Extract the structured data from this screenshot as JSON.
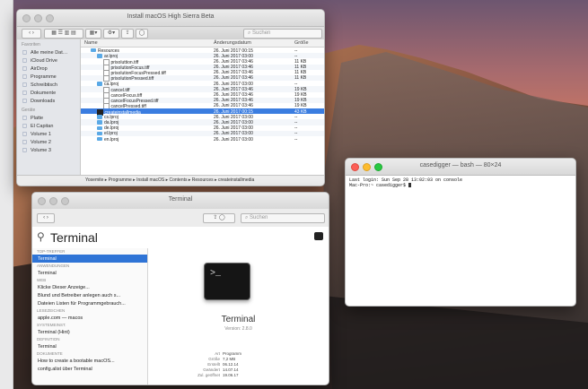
{
  "finder": {
    "title": "Install macOS High Sierra Beta",
    "search_placeholder": "Suchen",
    "columns": {
      "name": "Name",
      "date": "Änderungsdatum",
      "size": "Größe"
    },
    "sidebar": [
      {
        "type": "section",
        "label": "Favoriten"
      },
      {
        "type": "item",
        "label": "Alle meine Dat…",
        "icon": "all-files-icon"
      },
      {
        "type": "item",
        "label": "iCloud Drive",
        "icon": "cloud-icon"
      },
      {
        "type": "item",
        "label": "AirDrop",
        "icon": "airdrop-icon"
      },
      {
        "type": "item",
        "label": "Programme",
        "icon": "apps-icon"
      },
      {
        "type": "item",
        "label": "Schreibtisch",
        "icon": "desktop-icon"
      },
      {
        "type": "item",
        "label": "Dokumente",
        "icon": "documents-icon"
      },
      {
        "type": "item",
        "label": "Downloads",
        "icon": "downloads-icon"
      },
      {
        "type": "section",
        "label": "Geräte"
      },
      {
        "type": "item",
        "label": "Platte",
        "icon": "disk-icon"
      },
      {
        "type": "item",
        "label": "El Capitan",
        "icon": "disk-icon"
      },
      {
        "type": "item",
        "label": "Volume 1",
        "icon": "disk-icon"
      },
      {
        "type": "item",
        "label": "Volume 2",
        "icon": "disk-icon"
      },
      {
        "type": "item",
        "label": "Volume 3",
        "icon": "disk-icon"
      }
    ],
    "rows": [
      {
        "indent": 1,
        "kind": "folder",
        "name": "Resources",
        "date": "26. Juni 2017 00:15",
        "size": "--"
      },
      {
        "indent": 2,
        "kind": "folder",
        "name": "ar.lproj",
        "date": "26. Juni 2017 03:00",
        "size": "--"
      },
      {
        "indent": 3,
        "kind": "doc",
        "name": "prisoluttion.tiff",
        "date": "26. Juni 2017 03:46",
        "size": "11 KB"
      },
      {
        "indent": 3,
        "kind": "doc",
        "name": "prisolutionFocus.tiff",
        "date": "26. Juni 2017 03:46",
        "size": "11 KB"
      },
      {
        "indent": 3,
        "kind": "doc",
        "name": "prisolutionFocusPressed.tiff",
        "date": "26. Juni 2017 03:46",
        "size": "11 KB"
      },
      {
        "indent": 3,
        "kind": "doc",
        "name": "prisolutionPressed.tiff",
        "date": "26. Juni 2017 03:46",
        "size": "11 KB"
      },
      {
        "indent": 2,
        "kind": "folder",
        "name": "ca.lproj",
        "date": "26. Juni 2017 03:00",
        "size": "--"
      },
      {
        "indent": 3,
        "kind": "doc",
        "name": "cancel.tiff",
        "date": "26. Juni 2017 03:46",
        "size": "19 KB"
      },
      {
        "indent": 3,
        "kind": "doc",
        "name": "cancelFocus.tiff",
        "date": "26. Juni 2017 03:46",
        "size": "19 KB"
      },
      {
        "indent": 3,
        "kind": "doc",
        "name": "cancelFocusPressed.tiff",
        "date": "26. Juni 2017 03:46",
        "size": "19 KB"
      },
      {
        "indent": 3,
        "kind": "doc",
        "name": "cancelPressed.tiff",
        "date": "26. Juni 2017 03:46",
        "size": "19 KB"
      },
      {
        "indent": 2,
        "kind": "exec",
        "name": "createinstallmedia",
        "date": "26. Juni 2017 00:15",
        "size": "43 KB",
        "selected": true
      },
      {
        "indent": 2,
        "kind": "folder",
        "name": "cs.lproj",
        "date": "26. Juni 2017 03:00",
        "size": "--"
      },
      {
        "indent": 2,
        "kind": "folder",
        "name": "da.lproj",
        "date": "26. Juni 2017 03:00",
        "size": "--"
      },
      {
        "indent": 2,
        "kind": "folder",
        "name": "de.lproj",
        "date": "26. Juni 2017 03:00",
        "size": "--"
      },
      {
        "indent": 2,
        "kind": "folder",
        "name": "el.lproj",
        "date": "26. Juni 2017 03:00",
        "size": "--"
      },
      {
        "indent": 2,
        "kind": "folder",
        "name": "en.lproj",
        "date": "26. Juni 2017 03:00",
        "size": "--"
      }
    ],
    "pathbar": "Yosemite ▸ Programme ▸ Install macOS ▸ Contents ▸ Resources ▸ createinstallmedia"
  },
  "spotlight": {
    "title": "Terminal",
    "query": "Terminal",
    "search_placeholder": "Suchen",
    "results": [
      {
        "type": "section",
        "label": "Top-Treffer"
      },
      {
        "type": "item",
        "label": "Terminal",
        "selected": true
      },
      {
        "type": "section",
        "label": "Anwendungen"
      },
      {
        "type": "item",
        "label": "Terminal"
      },
      {
        "type": "section",
        "label": "Web"
      },
      {
        "type": "item",
        "label": "Klicke Dieser Anzeige..."
      },
      {
        "type": "item",
        "label": "Blund und Betreiber anlegen auch s..."
      },
      {
        "type": "item",
        "label": "Dateien Listen für Programmgebrauch..."
      },
      {
        "type": "section",
        "label": "Lesezeichen"
      },
      {
        "type": "item",
        "label": "apple.com — macos"
      },
      {
        "type": "section",
        "label": "Systemeinst."
      },
      {
        "type": "item",
        "label": "Terminal (Hint)"
      },
      {
        "type": "section",
        "label": "Definition"
      },
      {
        "type": "item",
        "label": "Terminal"
      },
      {
        "type": "section",
        "label": "Dokumente"
      },
      {
        "type": "item",
        "label": "How to create a bootable macOS..."
      },
      {
        "type": "item",
        "label": "config.alist über Terminal"
      }
    ],
    "preview": {
      "app_name": "Terminal",
      "version": "Version: 2.8.0",
      "meta": [
        {
          "k": "Art",
          "v": "Programm"
        },
        {
          "k": "Größe",
          "v": "7,2 MB"
        },
        {
          "k": "Erstellt",
          "v": "06.12.14"
        },
        {
          "k": "Geändert",
          "v": "14.07.14"
        },
        {
          "k": "Zul. geöffnet",
          "v": "19.06.17"
        }
      ]
    }
  },
  "terminal": {
    "title": "casedigger — bash — 80×24",
    "lines": [
      "Last login: Sun Sep 28 13:02:03 on console",
      "Mac-Pro:~ casedigger$ "
    ]
  },
  "colors": {
    "selection": "#3b7de0",
    "close": "#fc5f57",
    "minimize": "#fdbc2e",
    "zoom": "#28c840"
  }
}
